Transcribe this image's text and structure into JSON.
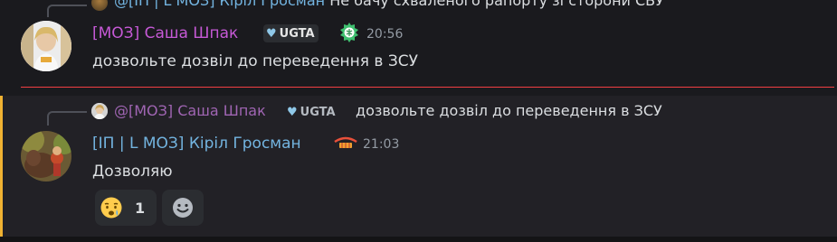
{
  "prev_reply": {
    "author": "@[ІП | L МОЗ] Кіріл Гросман",
    "text": "Не бачу схваленого рапорту зі сторони СБУ"
  },
  "message1": {
    "username": "[МОЗ] Саша Шпак",
    "tag": "UGTA",
    "timestamp": "20:56",
    "content": "дозвольте дозвіл до переведення в ЗСУ"
  },
  "message2": {
    "reply": {
      "author": "@[МОЗ] Саша Шпак",
      "tag": "UGTA",
      "text": "дозвольте дозвіл до переведення в ЗСУ"
    },
    "username": "[ІП | L МОЗ] Кіріл Гросман",
    "timestamp": "21:03",
    "content": "Дозволяю",
    "reactions": [
      {
        "emoji": "crying-face",
        "count": "1"
      },
      {
        "emoji": "add-reaction",
        "count": ""
      }
    ]
  },
  "colors": {
    "background": "#1a1a1e",
    "highlight": "#222126",
    "accent_bar": "#f0b232",
    "divider": "#f23f43",
    "username_moz": "#c659d6",
    "username_ip": "#73b4e0",
    "text": "#dbdee1",
    "muted": "#949ba4"
  }
}
